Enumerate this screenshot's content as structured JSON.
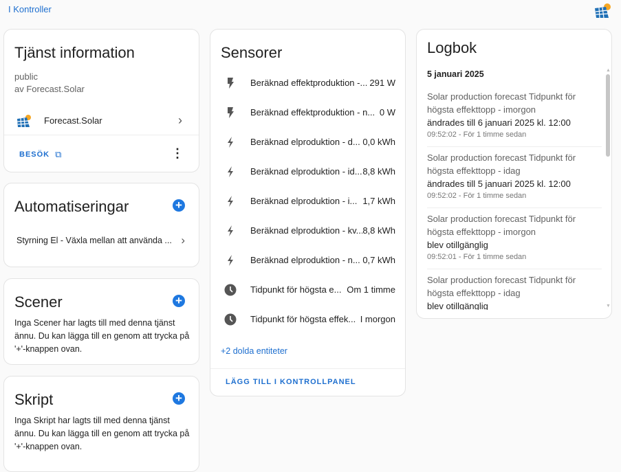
{
  "breadcrumb": "I Kontroller",
  "info": {
    "title": "Tjänst information",
    "line1": "public",
    "line2": "av Forecast.Solar",
    "integration": "Forecast.Solar",
    "visit": "BESÖK"
  },
  "automations": {
    "title": "Automatiseringar",
    "items": [
      "Styrning El - Växla mellan att använda ..."
    ]
  },
  "scenes": {
    "title": "Scener",
    "text": "Inga Scener har lagts till med denna tjänst ännu. Du kan lägga till en genom att trycka på '+'-knappen ovan."
  },
  "scripts": {
    "title": "Skript",
    "text": "Inga Skript har lagts till med denna tjänst ännu. Du kan lägga till en genom att trycka på '+'-knappen ovan."
  },
  "sensors": {
    "title": "Sensorer",
    "items": [
      {
        "name": "Beräknad effektproduktion -...",
        "value": "291 W",
        "icon": "flash"
      },
      {
        "name": "Beräknad effektproduktion - n...",
        "value": "0 W",
        "icon": "flash"
      },
      {
        "name": "Beräknad elproduktion - d...",
        "value": "0,0 kWh",
        "icon": "lightning"
      },
      {
        "name": "Beräknad elproduktion - id...",
        "value": "8,8 kWh",
        "icon": "lightning"
      },
      {
        "name": "Beräknad elproduktion - i...",
        "value": "1,7 kWh",
        "icon": "lightning"
      },
      {
        "name": "Beräknad elproduktion - kv...",
        "value": "8,8 kWh",
        "icon": "lightning"
      },
      {
        "name": "Beräknad elproduktion - n...",
        "value": "0,7 kWh",
        "icon": "lightning"
      },
      {
        "name": "Tidpunkt för högsta e...",
        "value": "Om 1 timme",
        "icon": "clock"
      },
      {
        "name": "Tidpunkt för högsta effek...",
        "value": "I morgon",
        "icon": "clock"
      }
    ],
    "hidden": "+2 dolda entiteter",
    "add": "LÄGG TILL I KONTROLLPANEL"
  },
  "logbook": {
    "title": "Logbok",
    "date": "5 januari 2025",
    "entries": [
      {
        "title": "Solar production forecast Tidpunkt för högsta effekttopp - imorgon",
        "change": "ändrades till 6 januari 2025 kl. 12:00",
        "time": "09:52:02 - För 1 timme sedan"
      },
      {
        "title": "Solar production forecast Tidpunkt för högsta effekttopp - idag",
        "change": "ändrades till 5 januari 2025 kl. 12:00",
        "time": "09:52:02 - För 1 timme sedan"
      },
      {
        "title": "Solar production forecast Tidpunkt för högsta effekttopp - imorgon",
        "change": "blev otillgänglig",
        "time": "09:52:01 - För 1 timme sedan"
      },
      {
        "title": "Solar production forecast Tidpunkt för högsta effekttopp - idag",
        "change": "blev otillgänglig",
        "time": ""
      }
    ]
  },
  "colors": {
    "accent": "#1e6fcf",
    "plus": "#1e78e0"
  }
}
